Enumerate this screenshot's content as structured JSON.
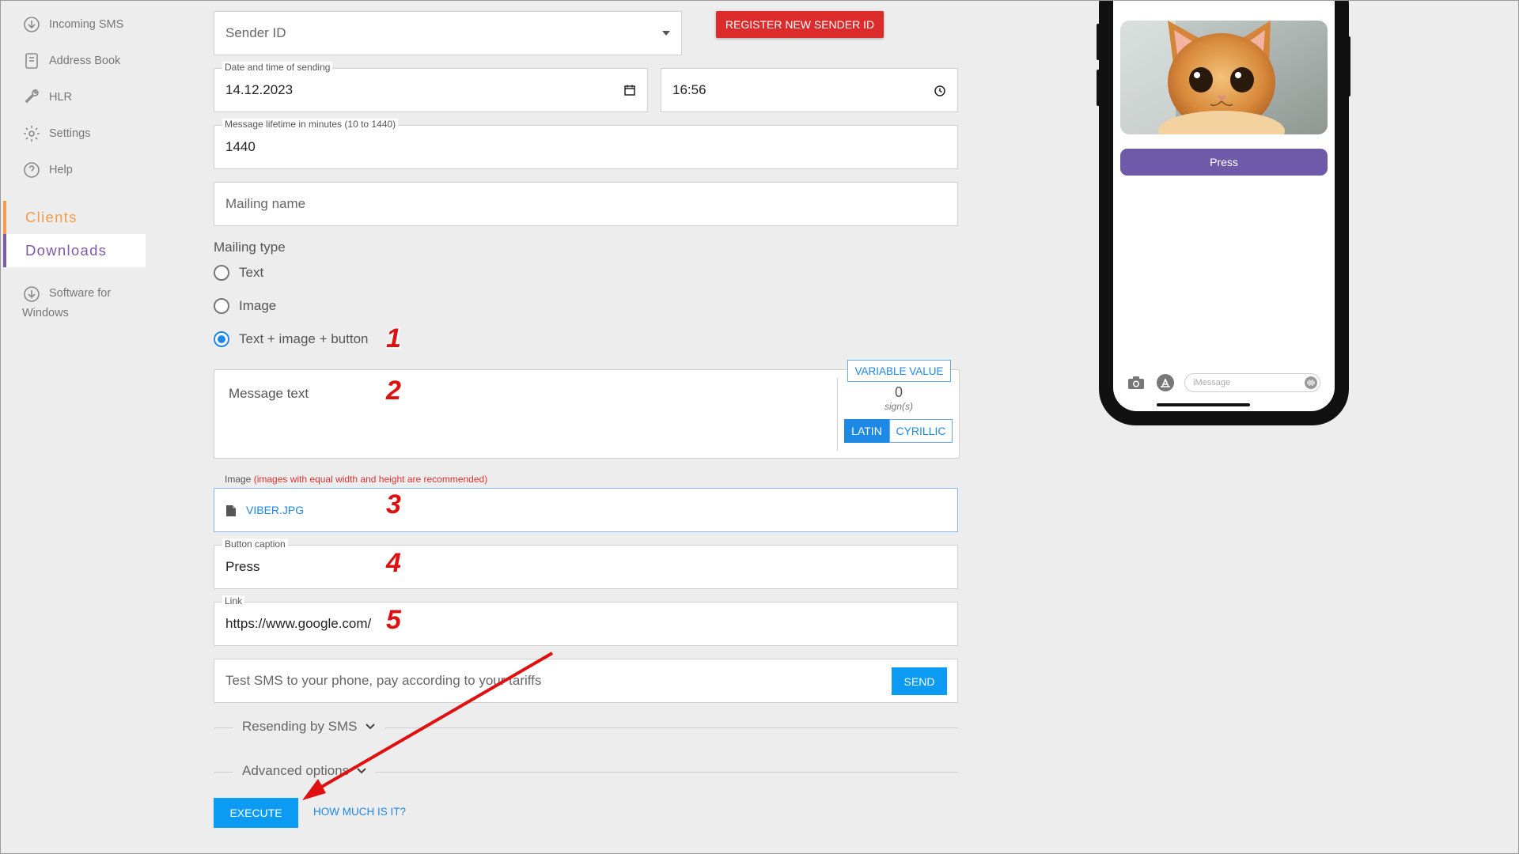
{
  "sidebar": {
    "items": [
      {
        "label": "Incoming SMS",
        "icon": "download-circle-icon"
      },
      {
        "label": "Address Book",
        "icon": "book-icon"
      },
      {
        "label": "HLR",
        "icon": "wrench-icon"
      },
      {
        "label": "Settings",
        "icon": "gear-icon"
      },
      {
        "label": "Help",
        "icon": "help-circle-icon"
      }
    ],
    "sections": {
      "clients": "Clients",
      "downloads": "Downloads"
    },
    "software": {
      "line1": "Software for",
      "line2": "Windows",
      "icon": "download-circle-icon"
    }
  },
  "form": {
    "sender_placeholder": "Sender ID",
    "register_button": "REGISTER NEW SENDER ID",
    "date_label": "Date and time of sending",
    "date_value": "14.12.2023",
    "time_value": "16:56",
    "lifetime_label": "Message lifetime in minutes (10 to 1440)",
    "lifetime_value": "1440",
    "mailing_name_placeholder": "Mailing name",
    "mailing_type_heading": "Mailing type",
    "mailing_types": [
      "Text",
      "Image",
      "Text + image + button"
    ],
    "selected_type": "Text + image + button",
    "message_placeholder": "Message text",
    "variable_button": "VARIABLE VALUE",
    "char_count": "0",
    "signs_label": "sign(s)",
    "alphabet_options": [
      "LATIN",
      "CYRILLIC"
    ],
    "alphabet_selected": "LATIN",
    "image_label": "Image",
    "image_hint": "(images with equal width and height are recommended)",
    "image_file": "VIBER.JPG",
    "button_caption_label": "Button caption",
    "button_caption_value": "Press",
    "link_label": "Link",
    "link_value": "https://www.google.com/",
    "test_sms_placeholder": "Test SMS to your phone, pay according to your tariffs",
    "send_button": "SEND",
    "resending_label": "Resending by SMS",
    "advanced_label": "Advanced options",
    "execute_button": "EXECUTE",
    "price_link": "HOW MUCH IS IT?"
  },
  "annotations": [
    "1",
    "2",
    "3",
    "4",
    "5"
  ],
  "preview": {
    "button_label": "Press",
    "input_placeholder": "iMessage"
  },
  "colors": {
    "accent_blue": "#0c9bf2",
    "register_red": "#dc2b2b",
    "clients_orange": "#f59a4a",
    "downloads_purple": "#7b5aa6",
    "preview_button": "#6e5aa8",
    "annotation_red": "#e01010"
  }
}
